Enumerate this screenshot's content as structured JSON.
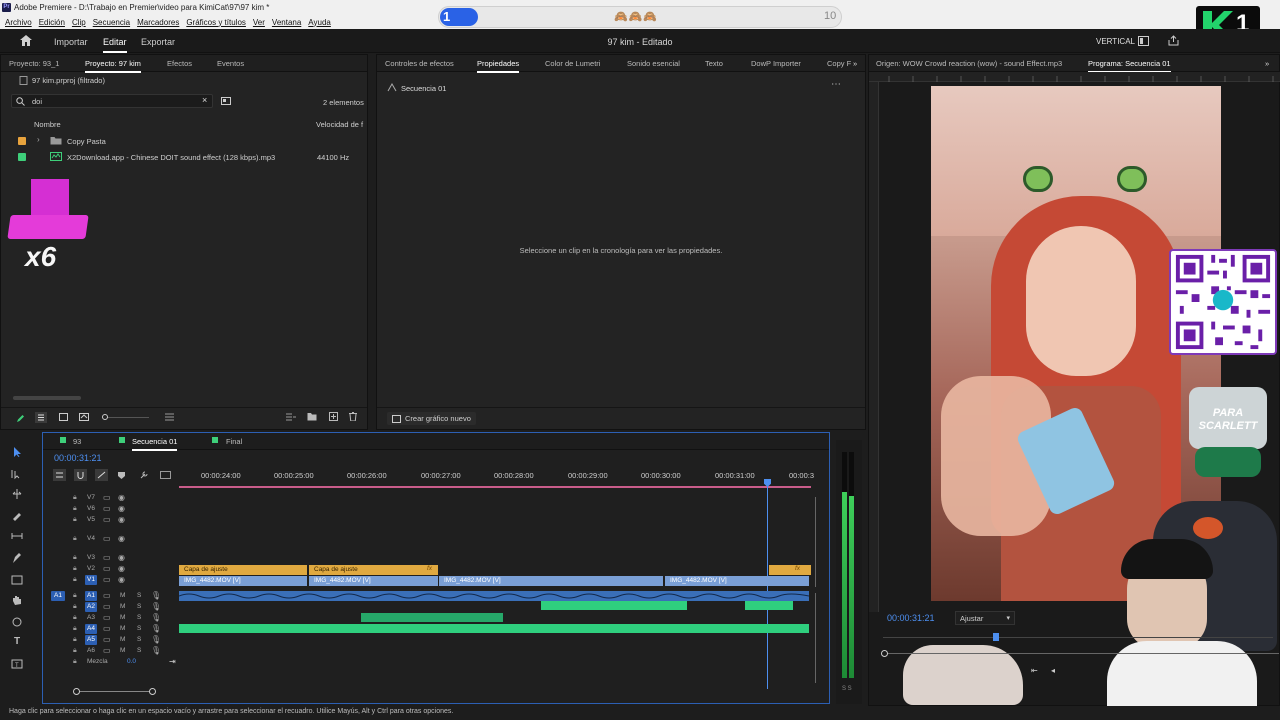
{
  "window": {
    "title": "Adobe Premiere - D:\\Trabajo en Premier\\video para KimiCat\\97\\97 kim *"
  },
  "menu": [
    "Archivo",
    "Edición",
    "Clip",
    "Secuencia",
    "Marcadores",
    "Gráficos y títulos",
    "Ver",
    "Ventana",
    "Ayuda"
  ],
  "overlay_bar": {
    "start": "1",
    "end": "10",
    "emojis": "🙈🙈🙈",
    "progress_fraction": 0.1,
    "fill_color": "#2a62e6"
  },
  "header": {
    "nav": [
      "Importar",
      "Editar",
      "Exportar"
    ],
    "active_nav": "Editar",
    "document": "97 kim - Editado",
    "layout_label": "VERTICAL"
  },
  "project": {
    "tabs": [
      "Proyecto: 93_1",
      "Proyecto: 97 kim",
      "Efectos",
      "Eventos"
    ],
    "filename": "97 kim.prproj (filtrado)",
    "search_value": "doi",
    "item_count": "2 elementos",
    "columns": [
      "Nombre",
      "Velocidad de f"
    ],
    "rows": [
      {
        "name": "Copy Pasta",
        "rate": "",
        "color": "#e8a33d"
      },
      {
        "name": "X2Download.app - Chinese DOIT sound effect (128 kbps).mp3",
        "rate": "44100 Hz",
        "color": "#3ecf7a"
      }
    ],
    "thumb_badge": "x6"
  },
  "props": {
    "tabs": [
      "Controles de efectos",
      "Propiedades",
      "Color de Lumetri",
      "Sonido esencial",
      "Texto",
      "DowP Importer",
      "Copy F"
    ],
    "sequence": "Secuencia 01",
    "empty_message": "Seleccione un clip en la cronología para ver las propiedades.",
    "new_graphic": "Crear gráfico nuevo"
  },
  "monitor": {
    "source_tab": "Origen: WOW Crowd reaction (wow) - sound Effect.mp3",
    "program_tab": "Programa: Secuencia 01",
    "timecode": "00:00:31:21",
    "fit": "Ajustar",
    "sticker_text": "PARA SCARLETT",
    "corner_logo": "1"
  },
  "timeline": {
    "tabs": [
      "93",
      "Secuencia 01",
      "Final"
    ],
    "timecode": "00:00:31:21",
    "ruler": [
      "00:00:24:00",
      "00:00:25:00",
      "00:00:26:00",
      "00:00:27:00",
      "00:00:28:00",
      "00:00:29:00",
      "00:00:30:00",
      "00:00:31:00",
      "00:00:3"
    ],
    "video_tracks": [
      "V7",
      "V6",
      "V5",
      "V4",
      "V3",
      "V2",
      "V1"
    ],
    "audio_tracks": [
      "A1",
      "A2",
      "A3",
      "A4",
      "A5",
      "A6"
    ],
    "mix_label": "Mezcla",
    "mix_value": "0.0",
    "clips_v2": [
      "Capa de ajuste",
      "Capa de ajuste"
    ],
    "clips_v1": [
      "IMG_4482.MOV [V]",
      "IMG_4482.MOV [V]",
      "IMG_4482.MOV [V]",
      "IMG_4482.MOV [V]"
    ],
    "track_letters": {
      "m": "M",
      "s": "S"
    }
  },
  "statusbar": "Haga clic para seleccionar o haga clic en un espacio vacío y arrastre para seleccionar el recuadro. Utilice Mayús, Alt y Ctrl para otras opciones."
}
